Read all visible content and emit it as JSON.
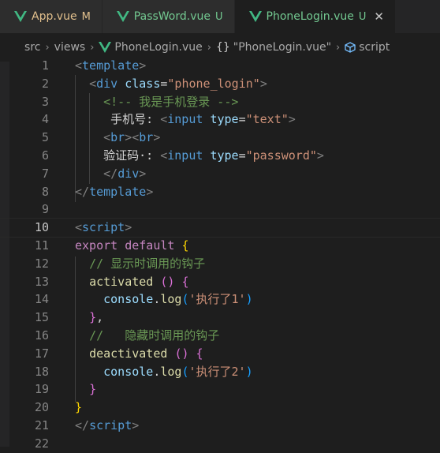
{
  "tabs": [
    {
      "name": "App.vue",
      "status": "M",
      "status_kind": "modified",
      "active": false
    },
    {
      "name": "PassWord.vue",
      "status": "U",
      "status_kind": "untracked",
      "active": false
    },
    {
      "name": "PhoneLogin.vue",
      "status": "U",
      "status_kind": "untracked",
      "active": true
    }
  ],
  "colors": {
    "vue_green": "#41b883",
    "modified": "#e2c08d",
    "untracked": "#73c991",
    "editor_bg": "#1e1e1e"
  },
  "breadcrumb": {
    "src": "src",
    "views": "views",
    "file": "PhoneLogin.vue",
    "section": "\"PhoneLogin.vue\"",
    "symbol": "script",
    "section_icon": "braces-icon",
    "symbol_icon": "cube-icon"
  },
  "current_line": 10,
  "lines": [
    {
      "n": "1",
      "tokens": [
        [
          "t-punc",
          "<"
        ],
        [
          "t-tag",
          "template"
        ],
        [
          "t-punc",
          ">"
        ]
      ]
    },
    {
      "n": "2",
      "tokens": [
        [
          "t-txt",
          "  "
        ],
        [
          "t-punc",
          "<"
        ],
        [
          "t-tag",
          "div"
        ],
        [
          "t-txt",
          " "
        ],
        [
          "t-attr",
          "class"
        ],
        [
          "t-txt",
          "="
        ],
        [
          "t-str",
          "\"phone_login\""
        ],
        [
          "t-punc",
          ">"
        ]
      ]
    },
    {
      "n": "3",
      "tokens": [
        [
          "t-txt",
          "    "
        ],
        [
          "t-cmt",
          "<!-- 我是手机登录 -->"
        ]
      ]
    },
    {
      "n": "4",
      "tokens": [
        [
          "t-txt",
          "     手机号: "
        ],
        [
          "t-punc",
          "<"
        ],
        [
          "t-tag",
          "input"
        ],
        [
          "t-txt",
          " "
        ],
        [
          "t-attr",
          "type"
        ],
        [
          "t-txt",
          "="
        ],
        [
          "t-str",
          "\"text\""
        ],
        [
          "t-punc",
          ">"
        ]
      ]
    },
    {
      "n": "5",
      "tokens": [
        [
          "t-txt",
          "    "
        ],
        [
          "t-punc",
          "<"
        ],
        [
          "t-tag",
          "br"
        ],
        [
          "t-punc",
          "><"
        ],
        [
          "t-tag",
          "br"
        ],
        [
          "t-punc",
          ">"
        ]
      ]
    },
    {
      "n": "6",
      "tokens": [
        [
          "t-txt",
          "    验证码·: "
        ],
        [
          "t-punc",
          "<"
        ],
        [
          "t-tag",
          "input"
        ],
        [
          "t-txt",
          " "
        ],
        [
          "t-attr",
          "type"
        ],
        [
          "t-txt",
          "="
        ],
        [
          "t-str",
          "\"password\""
        ],
        [
          "t-punc",
          ">"
        ]
      ]
    },
    {
      "n": "7",
      "tokens": [
        [
          "t-txt",
          "    "
        ],
        [
          "t-punc",
          "</"
        ],
        [
          "t-tag",
          "div"
        ],
        [
          "t-punc",
          ">"
        ]
      ]
    },
    {
      "n": "8",
      "tokens": [
        [
          "t-punc",
          "</"
        ],
        [
          "t-tag",
          "template"
        ],
        [
          "t-punc",
          ">"
        ]
      ]
    },
    {
      "n": "9",
      "tokens": []
    },
    {
      "n": "10",
      "tokens": [
        [
          "t-punc",
          "<"
        ],
        [
          "t-tag",
          "script"
        ],
        [
          "t-punc",
          ">"
        ]
      ]
    },
    {
      "n": "11",
      "tokens": [
        [
          "t-kw",
          "export"
        ],
        [
          "t-txt",
          " "
        ],
        [
          "t-kw",
          "default"
        ],
        [
          "t-txt",
          " "
        ],
        [
          "t-brace",
          "{"
        ]
      ]
    },
    {
      "n": "12",
      "tokens": [
        [
          "t-txt",
          "  "
        ],
        [
          "t-cmt",
          "// 显示时调用的钩子"
        ]
      ]
    },
    {
      "n": "13",
      "tokens": [
        [
          "t-txt",
          "  "
        ],
        [
          "t-fn",
          "activated"
        ],
        [
          "t-txt",
          " "
        ],
        [
          "t-paren",
          "()"
        ],
        [
          "t-txt",
          " "
        ],
        [
          "t-paren",
          "{"
        ]
      ]
    },
    {
      "n": "14",
      "tokens": [
        [
          "t-txt",
          "    "
        ],
        [
          "t-attr",
          "console"
        ],
        [
          "t-txt",
          "."
        ],
        [
          "t-fn",
          "log"
        ],
        [
          "t-paren2",
          "("
        ],
        [
          "t-str",
          "'执行了1'"
        ],
        [
          "t-paren2",
          ")"
        ]
      ]
    },
    {
      "n": "15",
      "tokens": [
        [
          "t-txt",
          "  "
        ],
        [
          "t-paren",
          "}"
        ],
        [
          "t-txt",
          ","
        ]
      ]
    },
    {
      "n": "16",
      "tokens": [
        [
          "t-txt",
          "  "
        ],
        [
          "t-cmt",
          "//   隐藏时调用的钩子"
        ]
      ]
    },
    {
      "n": "17",
      "tokens": [
        [
          "t-txt",
          "  "
        ],
        [
          "t-fn",
          "deactivated"
        ],
        [
          "t-txt",
          " "
        ],
        [
          "t-paren",
          "()"
        ],
        [
          "t-txt",
          " "
        ],
        [
          "t-paren",
          "{"
        ]
      ]
    },
    {
      "n": "18",
      "tokens": [
        [
          "t-txt",
          "    "
        ],
        [
          "t-attr",
          "console"
        ],
        [
          "t-txt",
          "."
        ],
        [
          "t-fn",
          "log"
        ],
        [
          "t-paren2",
          "("
        ],
        [
          "t-str",
          "'执行了2'"
        ],
        [
          "t-paren2",
          ")"
        ]
      ]
    },
    {
      "n": "19",
      "tokens": [
        [
          "t-txt",
          "  "
        ],
        [
          "t-paren",
          "}"
        ]
      ]
    },
    {
      "n": "20",
      "tokens": [
        [
          "t-brace",
          "}"
        ]
      ]
    },
    {
      "n": "21",
      "tokens": [
        [
          "t-punc",
          "</"
        ],
        [
          "t-tag",
          "script"
        ],
        [
          "t-punc",
          ">"
        ]
      ]
    },
    {
      "n": "22",
      "tokens": []
    }
  ]
}
